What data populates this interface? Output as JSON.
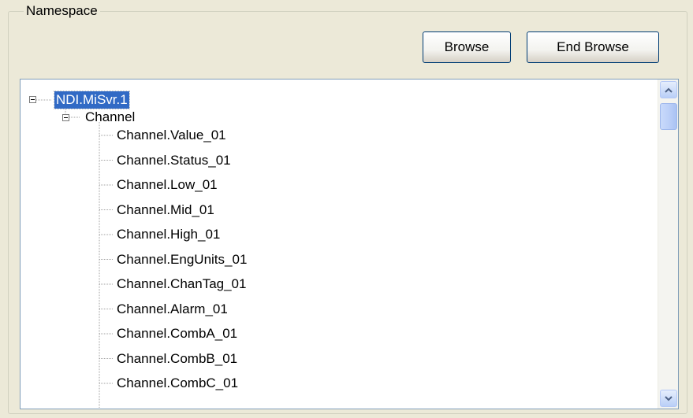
{
  "groupbox": {
    "label": "Namespace"
  },
  "buttons": {
    "browse": "Browse",
    "end_browse": "End Browse"
  },
  "tree": {
    "root": {
      "label": "NDI.MiSvr.1",
      "expanded": true,
      "selected": true
    },
    "channel": {
      "label": "Channel",
      "expanded": true
    },
    "items": [
      "Channel.Value_01",
      "Channel.Status_01",
      "Channel.Low_01",
      "Channel.Mid_01",
      "Channel.High_01",
      "Channel.EngUnits_01",
      "Channel.ChanTag_01",
      "Channel.Alarm_01",
      "Channel.CombA_01",
      "Channel.CombB_01",
      "Channel.CombC_01"
    ]
  },
  "scrollbar": {
    "up_icon": "arrow-up-icon",
    "down_icon": "arrow-down-icon"
  },
  "colors": {
    "selection": "#316ac5",
    "window_bg": "#ece9d8"
  }
}
